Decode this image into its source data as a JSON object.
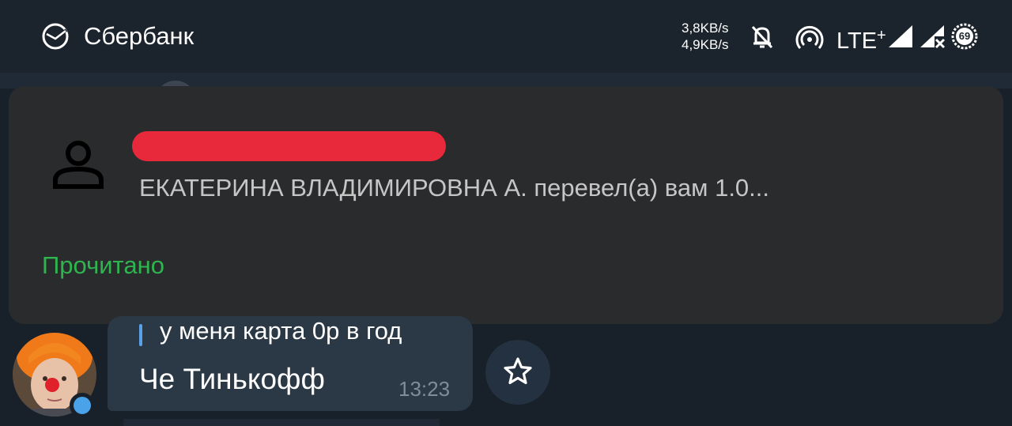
{
  "statusbar": {
    "app_name": "Сбербанк",
    "net_speed_up": "3,8KB/s",
    "net_speed_down": "4,9KB/s",
    "network_type": "LTE",
    "network_plus": "+",
    "battery_level": "69",
    "icons": [
      "sberbank-logo-icon",
      "bell-off-icon",
      "hotspot-icon",
      "signal-icon",
      "signal-x-icon",
      "battery-saver-icon"
    ]
  },
  "notification": {
    "text": "ЕКАТЕРИНА ВЛАДИМИРОВНА А. перевел(а) вам 1.0...",
    "action_label": "Прочитано",
    "action_color": "#2eb54f",
    "redaction_color": "#e8283b",
    "icon": "person-icon"
  },
  "message": {
    "reply_text": "у меня карта 0р в год",
    "text": "Че Тинькофф",
    "time": "13:23",
    "online_indicator_color": "#4aa3e8",
    "star_button_icon": "star-icon"
  },
  "colors": {
    "background": "#18202a",
    "bubble": "#2b3846",
    "card": "#2a2b2d"
  }
}
